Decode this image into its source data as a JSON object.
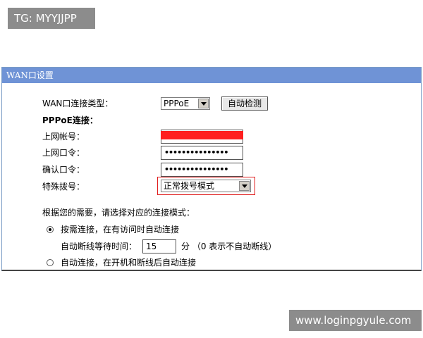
{
  "watermarks": {
    "top": "TG: MYYJJPP",
    "bottom": "www.loginpgyule.com"
  },
  "panel": {
    "title": "WAN口设置"
  },
  "form": {
    "conn_type_label": "WAN口连接类型：",
    "conn_type_value": "PPPoE",
    "auto_detect_button": "自动检测",
    "pppoe_heading": "PPPoE连接：",
    "account_label": "上网帐号：",
    "password_label": "上网口令：",
    "password_value": "•••••••••••••••",
    "confirm_label": "确认口令：",
    "confirm_value": "•••••••••••••••",
    "special_dial_label": "特殊拨号：",
    "special_dial_value": "正常拨号模式"
  },
  "mode": {
    "prompt": "根据您的需要，请选择对应的连接模式：",
    "option_on_demand": "按需连接，在有访问时自动连接",
    "idle_label": "自动断线等待时间：",
    "idle_value": "15",
    "idle_unit": "分 （0 表示不自动断线）",
    "option_auto": "自动连接，在开机和断线后自动连接",
    "selected": "on_demand"
  },
  "colors": {
    "header_bg": "#6f93d6",
    "redaction": "#ff1f1f",
    "highlight_border": "#e02020",
    "watermark_bg": "#8c8c8c"
  }
}
